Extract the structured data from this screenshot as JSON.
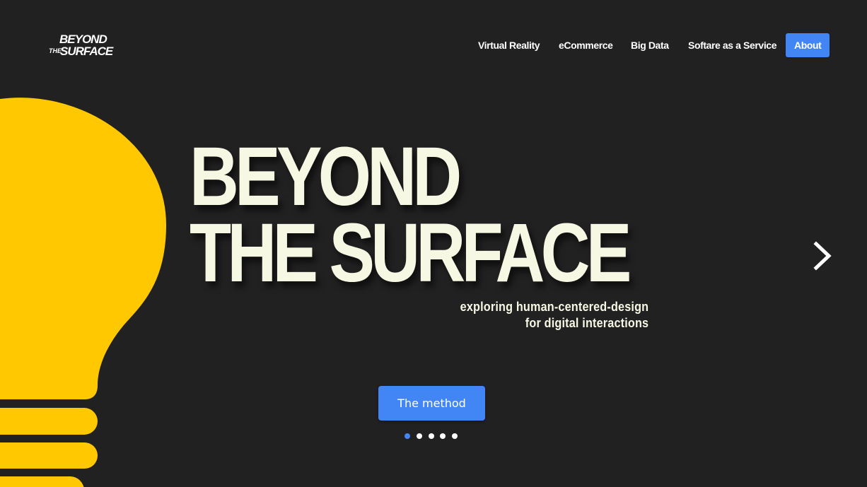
{
  "brand": {
    "logo_line1": "BEYOND",
    "logo_line2_small": "THE",
    "logo_line2": "SURFACE"
  },
  "nav": {
    "items": [
      {
        "label": "Virtual Reality"
      },
      {
        "label": "eCommerce"
      },
      {
        "label": "Big Data"
      },
      {
        "label": "Softare as a Service"
      },
      {
        "label": "About"
      }
    ]
  },
  "hero": {
    "title_line1": "BEYOND",
    "title_line2": "THE SURFACE",
    "tagline_line1": "exploring human-centered-design",
    "tagline_line2": "for digital interactions",
    "cta_label": "The method"
  },
  "carousel": {
    "slide_count": 5,
    "active_index": 0,
    "next_icon": "chevron-right-icon"
  },
  "colors": {
    "background": "#222122",
    "accent": "#4285f4",
    "bulb": "#ffc800",
    "title_text": "#f7f8e4"
  }
}
